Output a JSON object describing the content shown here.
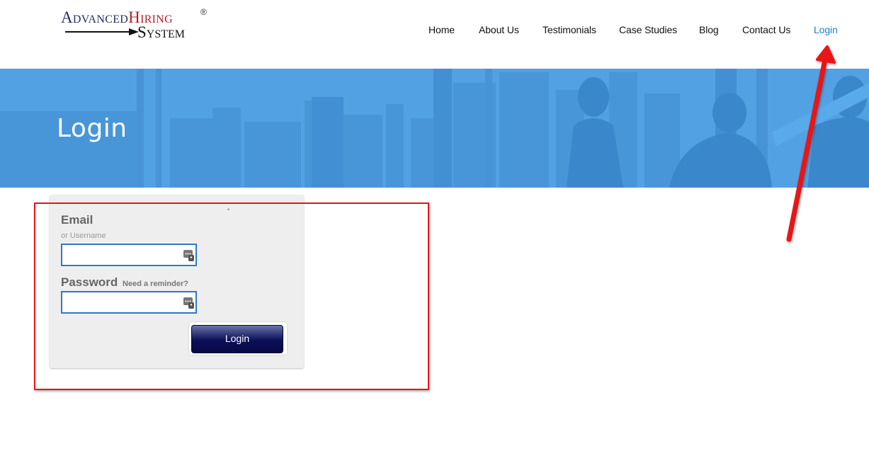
{
  "logo": {
    "line1_part1": "Advanced",
    "line1_part2": "Hiring",
    "line2": "System",
    "registered_mark": "®"
  },
  "nav": {
    "items": [
      {
        "label": "Home",
        "active": false
      },
      {
        "label": "About Us",
        "active": false
      },
      {
        "label": "Testimonials",
        "active": false
      },
      {
        "label": "Case Studies",
        "active": false
      },
      {
        "label": "Blog",
        "active": false
      },
      {
        "label": "Contact Us",
        "active": false
      },
      {
        "label": "Login",
        "active": true
      }
    ]
  },
  "banner": {
    "title": "Login"
  },
  "login_form": {
    "tiny_mark": "*",
    "email_label": "Email",
    "email_sub": "or Username",
    "email_value": "",
    "password_label": "Password",
    "password_hint": "Need a reminder?",
    "password_value": "",
    "submit_label": "Login",
    "field_icon": "password-manager-key-icon"
  },
  "colors": {
    "accent": "#1e7fd0",
    "banner_blue": "#4d9ee0",
    "button_navy": "#0b0f57",
    "annotation_red": "#e81414",
    "input_border": "#2f78c8"
  }
}
